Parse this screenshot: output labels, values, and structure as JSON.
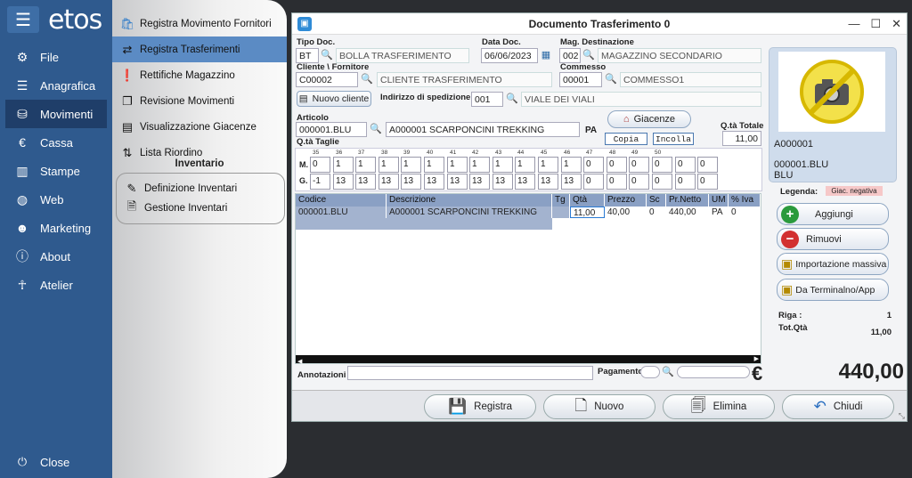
{
  "nav": {
    "brand": "etos",
    "items": [
      {
        "label": "File",
        "icon": "gear-icon"
      },
      {
        "label": "Anagrafica",
        "icon": "database-icon"
      },
      {
        "label": "Movimenti",
        "icon": "coins-icon"
      },
      {
        "label": "Cassa",
        "icon": "euro-icon"
      },
      {
        "label": "Stampe",
        "icon": "chart-icon"
      },
      {
        "label": "Web",
        "icon": "globe-icon"
      },
      {
        "label": "Marketing",
        "icon": "users-icon"
      },
      {
        "label": "About",
        "icon": "info-icon"
      },
      {
        "label": "Atelier",
        "icon": "person-icon"
      }
    ],
    "close": "Close"
  },
  "submenu": {
    "items": [
      "Registra Movimento Fornitori",
      "Registra Trasferimenti",
      "Rettifiche Magazzino",
      "Revisione Movimenti",
      "Visualizzazione Giacenze",
      "Lista Riordino"
    ],
    "section": "Inventario",
    "inventory": [
      "Definizione Inventari",
      "Gestione Inventari"
    ]
  },
  "window": {
    "title": "Documento Trasferimento 0",
    "labels": {
      "tipo_doc": "Tipo Doc.",
      "data_doc": "Data Doc.",
      "mag_dest": "Mag. Destinazione",
      "cliente": "Cliente \\ Fornitore",
      "commesso": "Commesso",
      "indirizzo": "Indirizzo di spedizione",
      "articolo": "Articolo",
      "qta_totale": "Q.tà Totale",
      "qta_taglie": "Q.tà Taglie",
      "m": "M.",
      "g": "G.",
      "annotazioni": "Annotazioni",
      "pagamento": "Pagamento"
    },
    "fields": {
      "tipo_doc_code": "BT",
      "tipo_doc_desc": "BOLLA TRASFERIMENTO",
      "data_doc": "06/06/2023",
      "mag_code": "002",
      "mag_desc": "MAGAZZINO SECONDARIO",
      "cliente_code": "C00002",
      "cliente_desc": "CLIENTE TRASFERIMENTO",
      "commesso_code": "00001",
      "commesso_desc": "COMMESSO1",
      "indirizzo_code": "001",
      "indirizzo_desc": "VIALE DEI VIALI",
      "articolo_code": "000001.BLU",
      "articolo_desc": "A000001 SCARPONCINI TREKKING",
      "pa": "PA",
      "qta_totale": "11,00",
      "annotazioni": "",
      "pagamento": ""
    },
    "buttons": {
      "nuovo_cliente": "Nuovo cliente",
      "giacenze": "Giacenze",
      "copia": "Copia",
      "incolla": "Incolla"
    },
    "sizes": [
      "35",
      "36",
      "37",
      "38",
      "39",
      "40",
      "41",
      "42",
      "43",
      "44",
      "45",
      "46",
      "47",
      "48",
      "49",
      "50",
      "",
      ""
    ],
    "m_values": [
      "0",
      "1",
      "1",
      "1",
      "1",
      "1",
      "1",
      "1",
      "1",
      "1",
      "1",
      "1",
      "0",
      "0",
      "0",
      "0",
      "0",
      "0"
    ],
    "g_values": [
      "-1",
      "13",
      "13",
      "13",
      "13",
      "13",
      "13",
      "13",
      "13",
      "13",
      "13",
      "13",
      "0",
      "0",
      "0",
      "0",
      "0",
      "0"
    ],
    "table": {
      "headers": [
        "Codice",
        "Descrizione",
        "Tg",
        "Qtà",
        "Prezzo",
        "Sc",
        "Pr.Netto",
        "UM",
        "% Iva"
      ],
      "rows": [
        [
          "000001.BLU",
          "A000001 SCARPONCINI TREKKING",
          "",
          "11,00",
          "40,00",
          "0",
          "440,00",
          "PA",
          "0"
        ]
      ]
    },
    "right": {
      "code": "A000001",
      "variant": "000001.BLU",
      "color": "BLU",
      "legenda_label": "Legenda:",
      "legenda_badge": "Giac. negativa",
      "aggiungi": "Aggiungi",
      "rimuovi": "Rimuovi",
      "importazione": "Importazione massiva",
      "terminalino": "Da Terminalno/App",
      "riga_label": "Riga :",
      "riga_value": "1",
      "tot_label": "Tot.Qtà",
      "tot_value": "11,00"
    },
    "euro": "€",
    "total": "440,00",
    "bottom": {
      "registra": "Registra",
      "nuovo": "Nuovo",
      "elimina": "Elimina",
      "chiudi": "Chiudi"
    }
  }
}
